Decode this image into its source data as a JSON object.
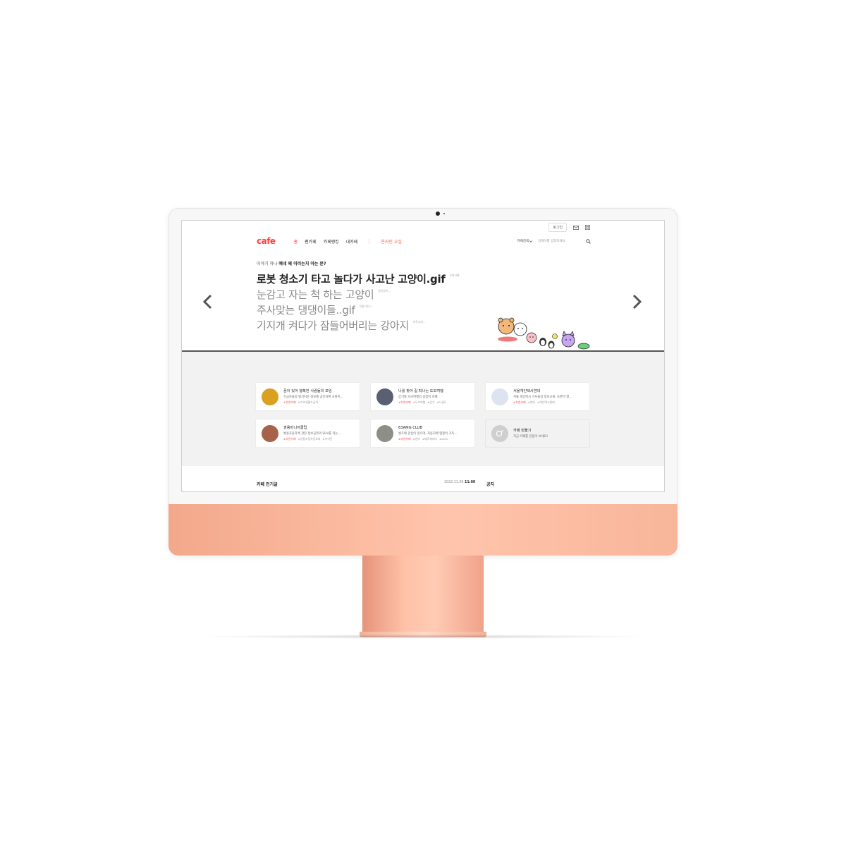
{
  "header": {
    "login_label": "로그인",
    "logo": "cafe",
    "nav": [
      "홈",
      "팬카페",
      "카페랭킹",
      "내카페"
    ],
    "nav_highlight": "온라인 교실",
    "search_scope": "카페검색",
    "search_placeholder": "검색어를 입력하세요",
    "accent_color": "#ff3f3f"
  },
  "hero": {
    "kicker_prefix": "이야기 하나 ",
    "kicker_bold": "얘네 왜 이러는지 아는 분?",
    "items": [
      {
        "title": "로봇 청소기 타고 놀다가 사고난 고양이.gif",
        "source": "주변카페"
      },
      {
        "title": "눈감고 자는 척 하는 고양이",
        "source": "꿀이양이..."
      },
      {
        "title": "주사맞는 댕댕이들..gif",
        "source": "의종카토시"
      },
      {
        "title": "기지개 켜다가 잠들어버리는 강아지",
        "source": "마모시대..."
      }
    ]
  },
  "cards": [
    {
      "title": "꿈이 있어 행복한 사람들의 모임",
      "desc": "수급자들의 탈기쉬운 정보를 공유하며 교류하...",
      "tags": [
        "#추천카페",
        "#기초생활수급자"
      ],
      "thumb": "#d9a11f"
    },
    {
      "title": "나를 찾아 길 떠나는 도보여행",
      "desc": "걷기와 도보여행의 길잡이 카페",
      "tags": [
        "#추천카페",
        "#도보여행",
        "#걷기",
        "#나갈도"
      ],
      "thumb": "#5b5f72"
    },
    {
      "title": "서울개인택시연대",
      "desc": "서울 개인택시 기사들의 정보교류, 토론이 열...",
      "tags": [
        "#추천카페",
        "#연대",
        "#개인택시연대"
      ],
      "thumb": "#dde3ef"
    },
    {
      "title": "쌍용마니아클럽",
      "desc": "쌍용자동차에 관한 정보공유와 SUV를 타는 ...",
      "tags": [
        "#추천카페",
        "#쌍용자동차동호회",
        "#카이런"
      ],
      "thumb": "#a7624b"
    },
    {
      "title": "63AMG CLUB",
      "desc": "벤츠에 관심이 있으며, 자동차에 열정이 가득...",
      "tags": [
        "#추천카페",
        "#벤츠",
        "#메르세데스",
        "#AMG"
      ],
      "thumb": "#8c8f86"
    },
    {
      "title": "카페 만들기",
      "desc": "지금 카페를 만들어 보세요!",
      "tags": [],
      "thumb": "#cfcfcf"
    }
  ],
  "popular": {
    "title": "카페 인기글",
    "date": "2022.11.09.",
    "time": "11:00",
    "notice_title": "공지"
  }
}
